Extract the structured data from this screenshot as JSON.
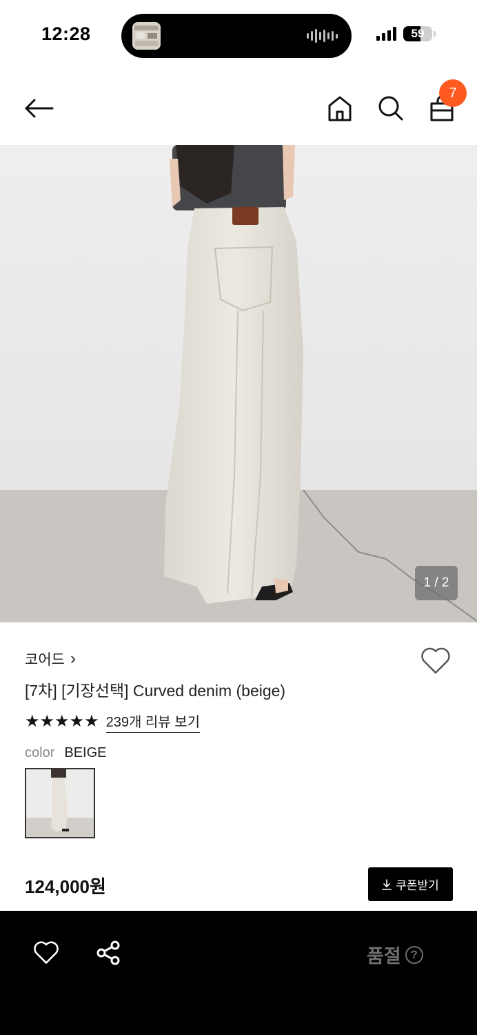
{
  "status_bar": {
    "time": "12:28",
    "battery": "59",
    "battery_level": 0.59,
    "signal_bars": 4
  },
  "header": {
    "back_icon": "arrow-left-icon",
    "home_icon": "home-icon",
    "search_icon": "search-icon",
    "cart_icon": "shopping-bag-icon",
    "cart_count": "7",
    "badge_color": "#ff5a1f"
  },
  "product": {
    "image_counter": "1 / 2",
    "brand": "코어드",
    "brand_chevron": "›",
    "title": "[7차] [기장선택] Curved denim (beige)",
    "rating_stars": 5,
    "stars_text": "★★★★★",
    "review_link": "239개 리뷰 보기",
    "color_label": "color",
    "color_value": "BEIGE",
    "price": "124,000원",
    "coupon_label": "쿠폰받기",
    "coupon_icon": "download-icon"
  },
  "bottom_bar": {
    "wish_icon": "heart-icon",
    "share_icon": "share-icon",
    "status_text": "품절",
    "help_icon": "question-icon",
    "help_glyph": "?"
  }
}
